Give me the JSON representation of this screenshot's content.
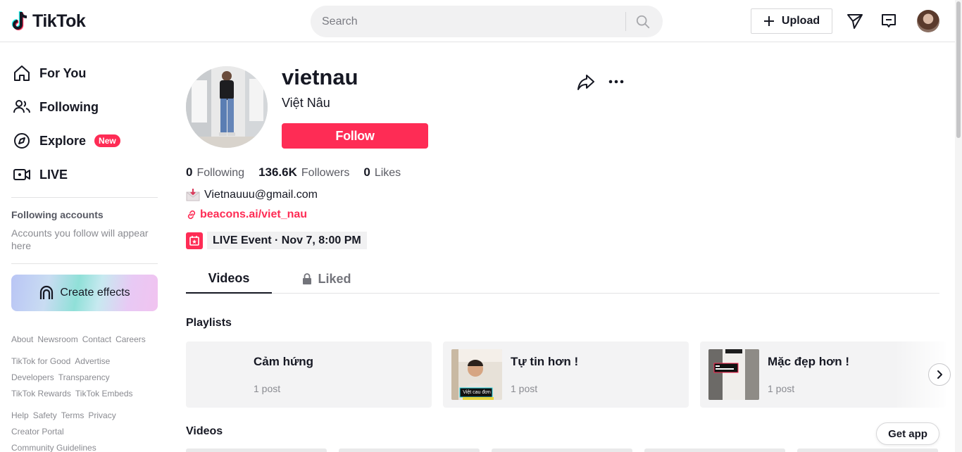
{
  "header": {
    "logo_text": "TikTok",
    "search_placeholder": "Search",
    "upload_label": "Upload"
  },
  "sidebar": {
    "nav": [
      {
        "label": "For You"
      },
      {
        "label": "Following"
      },
      {
        "label": "Explore",
        "badge": "New"
      },
      {
        "label": "LIVE"
      }
    ],
    "following_title": "Following accounts",
    "following_desc": "Accounts you follow will appear here",
    "create_effects": "Create effects",
    "footer": {
      "row1": [
        "About",
        "Newsroom",
        "Contact",
        "Careers"
      ],
      "row2": [
        "TikTok for Good",
        "Advertise"
      ],
      "row3": [
        "Developers",
        "Transparency"
      ],
      "row4": [
        "TikTok Rewards",
        "TikTok Embeds"
      ],
      "row5": [
        "Help",
        "Safety",
        "Terms",
        "Privacy"
      ],
      "row6": [
        "Creator Portal"
      ],
      "row7": [
        "Community Guidelines"
      ]
    }
  },
  "profile": {
    "username": "vietnau",
    "nickname": "Việt Nâu",
    "follow_label": "Follow",
    "stats": [
      {
        "value": "0",
        "label": "Following"
      },
      {
        "value": "136.6K",
        "label": "Followers"
      },
      {
        "value": "0",
        "label": "Likes"
      }
    ],
    "email": "Vietnauuu@gmail.com",
    "link": "beacons.ai/viet_nau",
    "live_event": "LIVE Event · Nov 7, 8:00 PM"
  },
  "tabs": {
    "videos": "Videos",
    "liked": "Liked"
  },
  "playlists": {
    "title": "Playlists",
    "items": [
      {
        "name": "Cảm hứng",
        "count": "1 post"
      },
      {
        "name": "Tự tin hơn !",
        "count": "1 post",
        "thumb_caption": "Việt cau đơn"
      },
      {
        "name": "Mặc đẹp hơn !",
        "count": "1 post"
      }
    ]
  },
  "videos_title": "Videos",
  "get_app": "Get app",
  "colors": {
    "accent": "#fe2c55",
    "text": "#161823",
    "muted": "#8a8b91"
  }
}
